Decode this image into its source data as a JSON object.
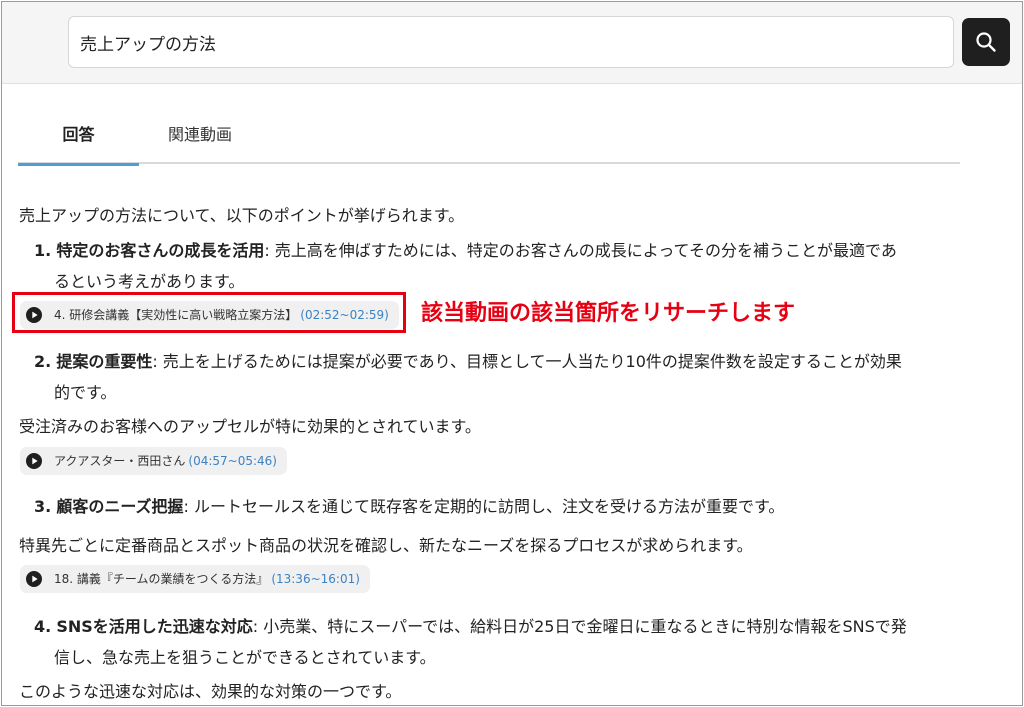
{
  "search": {
    "query": "売上アップの方法",
    "button_icon": "search-icon"
  },
  "tabs": [
    {
      "label": "回答",
      "active": true
    },
    {
      "label": "関連動画",
      "active": false
    }
  ],
  "answer": {
    "intro": "売上アップの方法について、以下のポイントが挙げられます。",
    "items": [
      {
        "number": "1.",
        "term": "特定のお客さんの成長を活用",
        "text_line1": ": 売上高を伸ばすためには、特定のお客さんの成長によってその分を補うことが最適であ",
        "text_line2": "るという考えがあります。"
      },
      {
        "number": "2.",
        "term": "提案の重要性",
        "text_line1": ": 売上を上げるためには提案が必要であり、目標として一人当たり10件の提案件数を設定することが効果",
        "text_line2": "的です。"
      },
      {
        "number": "3.",
        "term": "顧客のニーズ把握",
        "text_line1": ": ルートセールスを通じて既存客を定期的に訪問し、注文を受ける方法が重要です。"
      },
      {
        "number": "4.",
        "term": "SNSを活用した迅速な対応",
        "text_line1": ": 小売業、特にスーパーでは、給料日が25日で金曜日に重なるときに特別な情報をSNSで発",
        "text_line2": "信し、急な売上を狙うことができるとされています。"
      }
    ],
    "notes": [
      "受注済みのお客様へのアップセルが特に効果的とされています。",
      "特異先ごとに定番商品とスポット商品の状況を確認し、新たなニーズを探るプロセスが求められます。",
      "このような迅速な対応は、効果的な対策の一つです。"
    ],
    "videos": [
      {
        "title": "4. 研修会講義【実効性に高い戦略立案方法】",
        "time": "(02:52~02:59)"
      },
      {
        "title": "アクアスター・西田さん",
        "time": "(04:57~05:46)"
      },
      {
        "title": "18. 講義『チームの業績をつくる方法』",
        "time": "(13:36~16:01)"
      }
    ]
  },
  "annotation": {
    "text": "該当動画の該当箇所をリサーチします",
    "color": "#e60012"
  },
  "colors": {
    "accent": "#4a9fd8",
    "timestamp": "#3b82c4",
    "highlight": "#e60012"
  }
}
